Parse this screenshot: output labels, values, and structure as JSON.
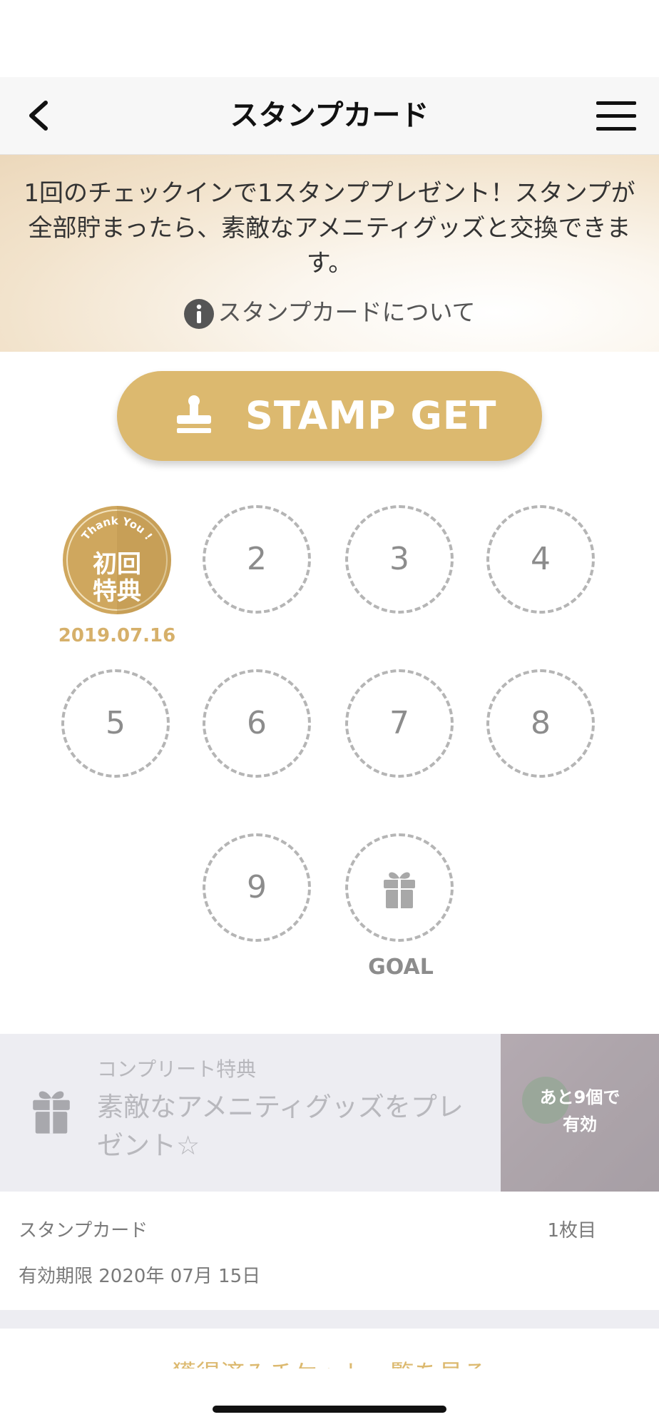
{
  "header": {
    "title": "スタンプカード"
  },
  "banner": {
    "description": "1回のチェックインで1スタンププレゼント！スタンプが全部貯まったら、素敵なアメニティグッズと交換できます。",
    "about_link": "スタンプカードについて"
  },
  "stamp_button": {
    "label": "STAMP GET"
  },
  "stamps": {
    "first": {
      "arc_text": "Thank You !",
      "line1": "初回",
      "line2": "特典",
      "date": "2019.07.16"
    },
    "slots": [
      "2",
      "3",
      "4",
      "5",
      "6",
      "7",
      "8",
      "9"
    ],
    "goal_label": "GOAL"
  },
  "reward": {
    "caption": "コンプリート特典",
    "text": "素敵なアメニティグッズをプレゼント☆",
    "status_line1": "あと9個で",
    "status_line2": "有効"
  },
  "card": {
    "name": "スタンプカード",
    "count": "1枚目",
    "expiry": "有効期限 2020年 07月 15日"
  },
  "footer": {
    "tickets_link": "獲得済みチケット一覧を見る"
  },
  "colors": {
    "accent": "#dcb96f",
    "slot_border": "#b5b5b5",
    "reward_bg": "#ededf2"
  }
}
